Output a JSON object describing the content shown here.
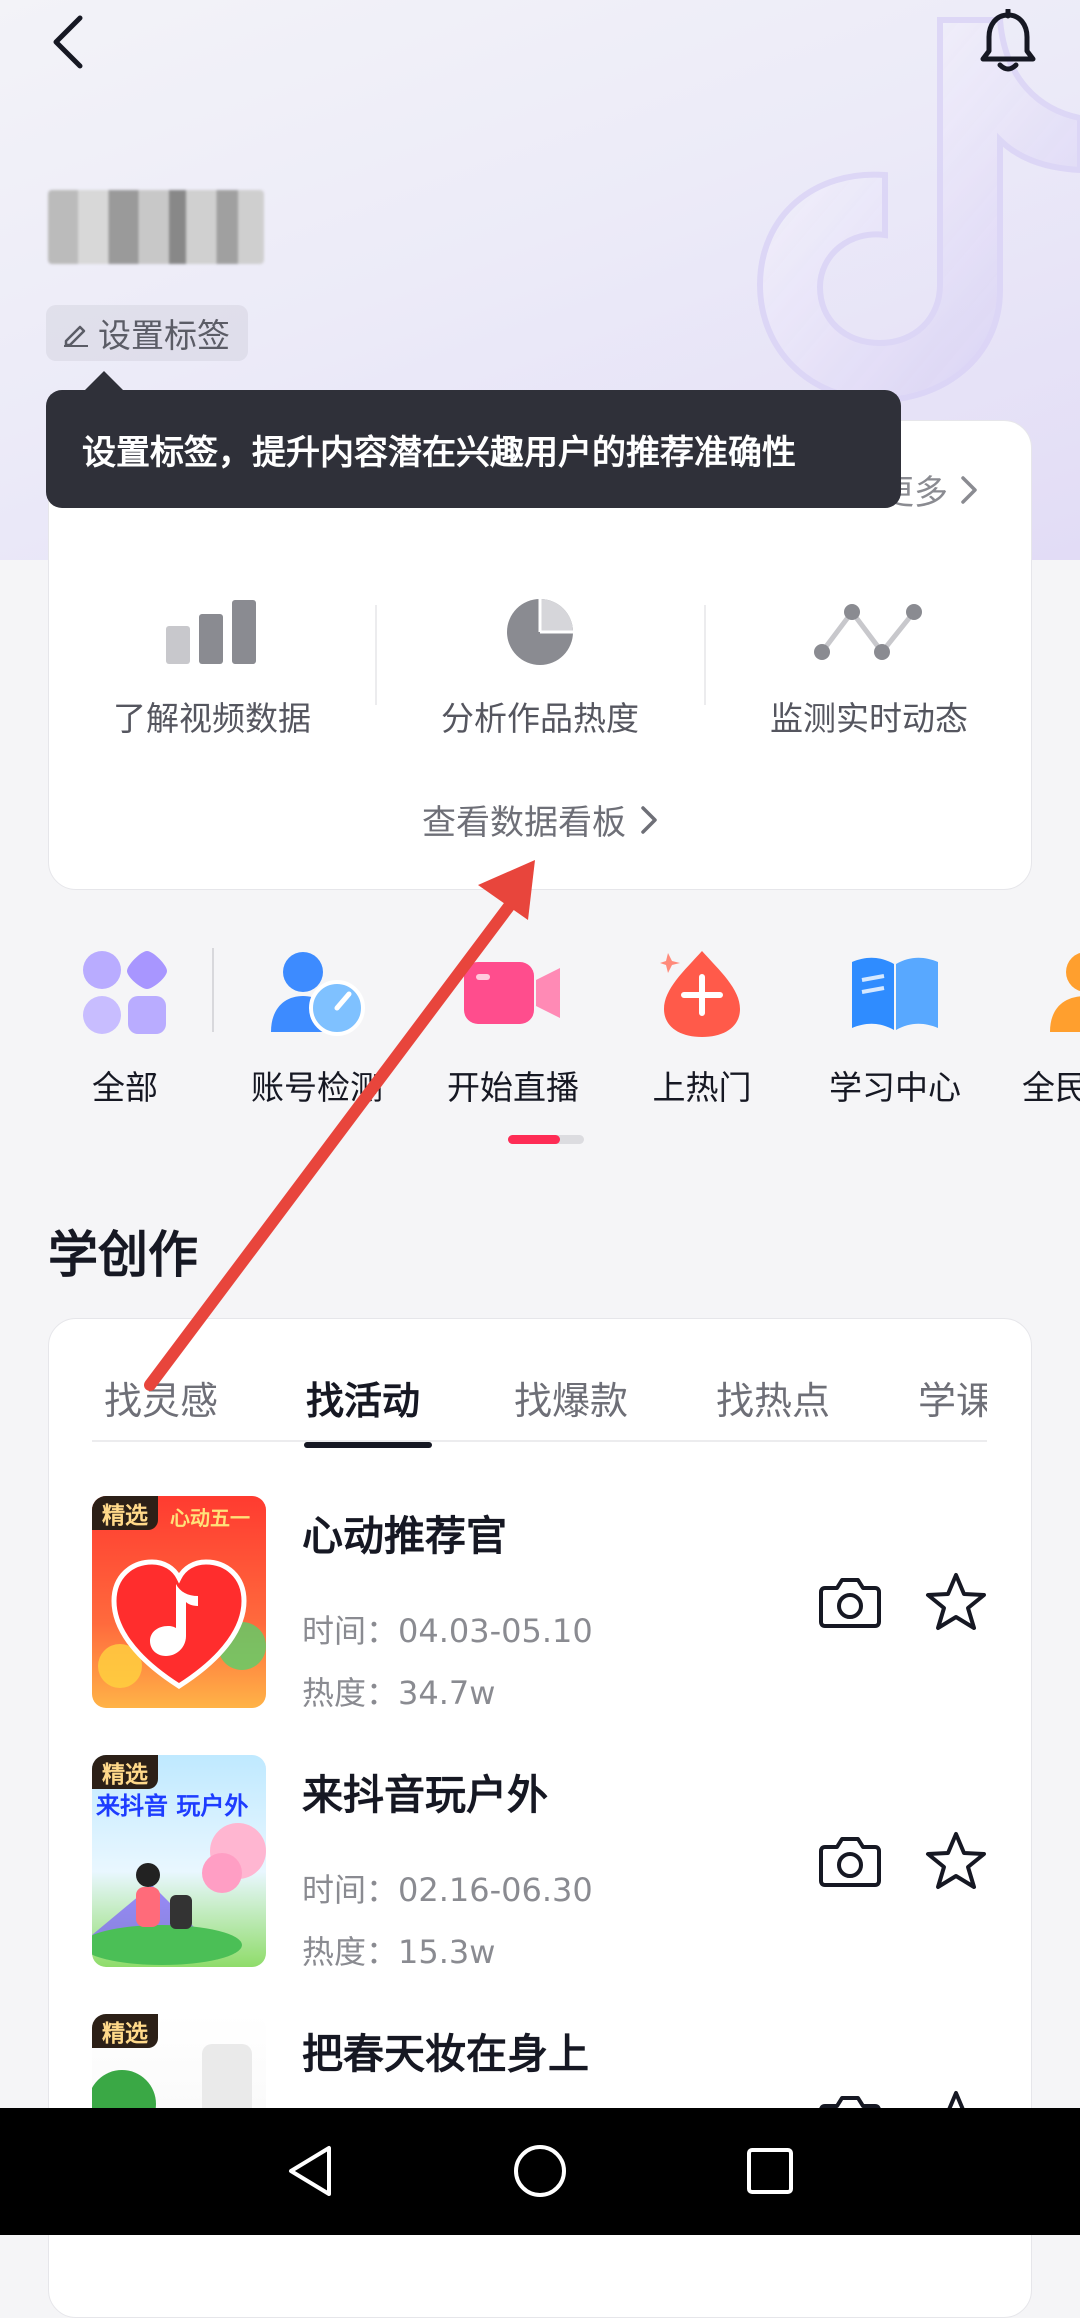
{
  "header": {
    "tag_button_label": "设置标签",
    "tooltip_text": "设置标签，提升内容潜在兴趣用户的推荐准确性",
    "more_label": "更多"
  },
  "data_card": {
    "features": [
      {
        "label": "了解视频数据",
        "icon": "bar-chart-icon"
      },
      {
        "label": "分析作品热度",
        "icon": "pie-chart-icon"
      },
      {
        "label": "监测实时动态",
        "icon": "line-chart-icon"
      }
    ],
    "board_link": "查看数据看板"
  },
  "entries": [
    {
      "label": "全部",
      "icon": "grid-icon"
    },
    {
      "label": "账号检测",
      "icon": "account-check-icon"
    },
    {
      "label": "开始直播",
      "icon": "live-camera-icon"
    },
    {
      "label": "上热门",
      "icon": "hot-drop-icon"
    },
    {
      "label": "学习中心",
      "icon": "book-icon"
    },
    {
      "label": "全民",
      "icon": "person-icon"
    }
  ],
  "learn": {
    "title": "学创作",
    "tabs": [
      "找灵感",
      "找活动",
      "找爆款",
      "找热点",
      "学课程"
    ],
    "active_tab": "找活动",
    "items": [
      {
        "badge": "精选",
        "title": "心动推荐官",
        "time": "时间：04.03-05.10",
        "heat": "热度：34.7w",
        "thumb_text": "心动五一"
      },
      {
        "badge": "精选",
        "title": "来抖音玩户外",
        "time": "时间：02.16-06.30",
        "heat": "热度：15.3w",
        "thumb_text": "来抖音 玩户外"
      },
      {
        "badge": "精选",
        "title": "把春天妆在身上",
        "time": "",
        "heat": ""
      }
    ]
  },
  "colors": {
    "accent": "#fe2c55",
    "tooltip_bg": "#2f3039",
    "annotation_arrow": "#e8453c"
  }
}
